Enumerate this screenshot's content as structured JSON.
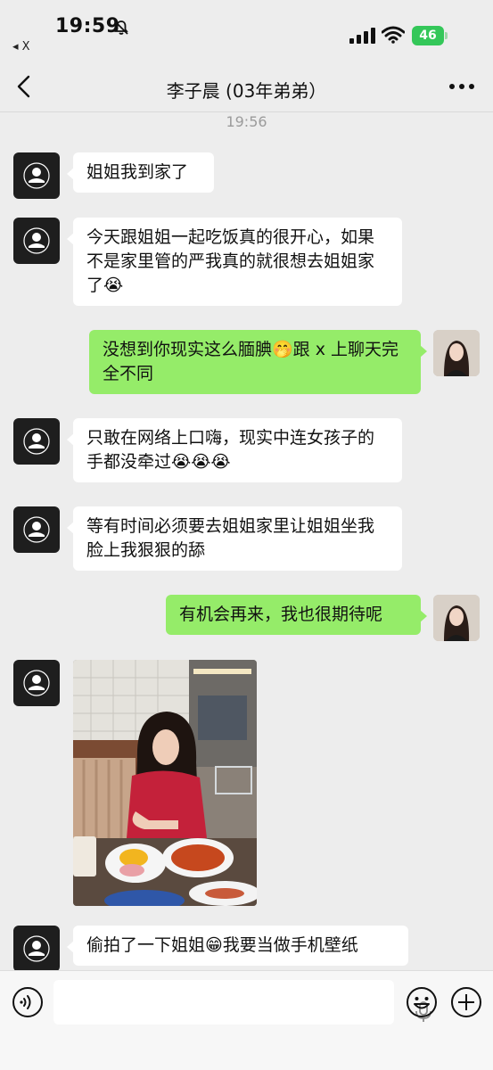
{
  "status_bar": {
    "time": "19:59",
    "back_app": "◂ X",
    "battery": "46"
  },
  "chat": {
    "title": "李子晨 (03年弟弟）",
    "timestamp": "19:56"
  },
  "messages": [
    {
      "side": "left",
      "text": "姐姐我到家了"
    },
    {
      "side": "left",
      "text": "今天跟姐姐一起吃饭真的很开心，如果不是家里管的严我真的就很想去姐姐家了😭"
    },
    {
      "side": "right",
      "text": "没想到你现实这么腼腆🤭跟 x 上聊天完全不同"
    },
    {
      "side": "left",
      "text": "只敢在网络上口嗨，现实中连女孩子的手都没牵过😭😭😭"
    },
    {
      "side": "left",
      "text": "等有时间必须要去姐姐家里让姐姐坐我脸上我狠狠的舔"
    },
    {
      "side": "right",
      "text": "有机会再来，我也很期待呢"
    },
    {
      "side": "left",
      "type": "image"
    },
    {
      "side": "left",
      "text": "偷拍了一下姐姐😁我要当做手机壁纸"
    }
  ],
  "icons": {
    "bell": "bell-slash-icon",
    "signal": "cellular-signal-icon",
    "wifi": "wifi-icon",
    "back": "chevron-left-icon",
    "more": "more-dots-icon",
    "voice": "voice-input-icon",
    "mic": "microphone-icon",
    "emoji": "emoji-icon",
    "plus": "plus-icon"
  },
  "colors": {
    "background": "#ededed",
    "incoming_bubble": "#ffffff",
    "outgoing_bubble": "#95ec69",
    "battery": "#34c759"
  }
}
